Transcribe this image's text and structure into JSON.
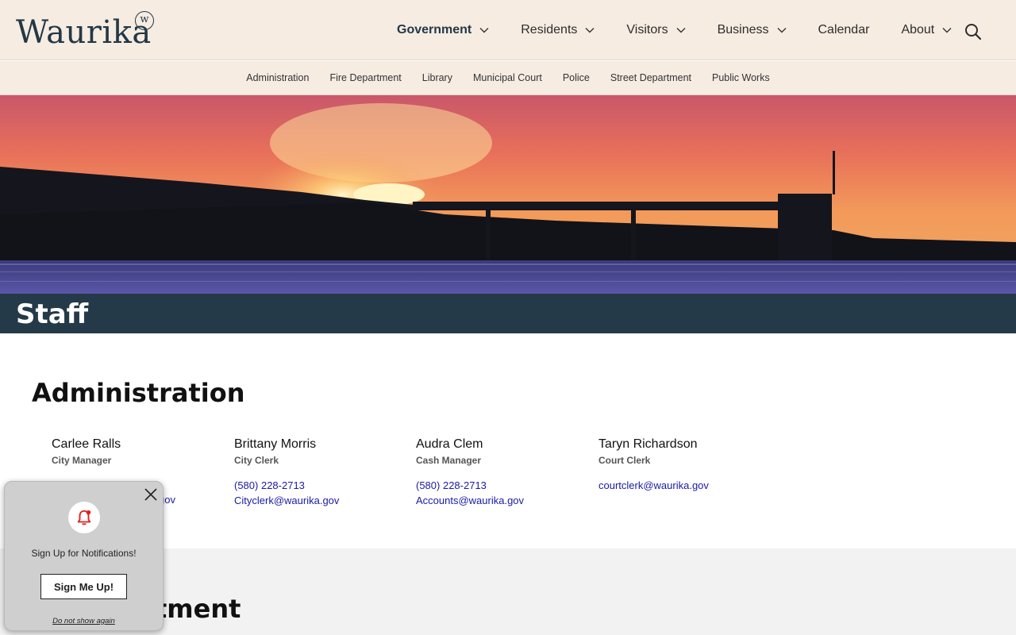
{
  "header": {
    "logo_text": "Waurika",
    "logo_mark": "w",
    "nav": [
      {
        "label": "Government",
        "has_dropdown": true,
        "active": true
      },
      {
        "label": "Residents",
        "has_dropdown": true
      },
      {
        "label": "Visitors",
        "has_dropdown": true
      },
      {
        "label": "Business",
        "has_dropdown": true
      },
      {
        "label": "Calendar",
        "has_dropdown": false
      },
      {
        "label": "About",
        "has_dropdown": true
      }
    ],
    "search_icon": "search-icon"
  },
  "subnav": [
    "Administration",
    "Fire Department",
    "Library",
    "Municipal Court",
    "Police",
    "Street Department",
    "Public Works"
  ],
  "page": {
    "title": "Staff"
  },
  "sections": {
    "administration": {
      "title": "Administration",
      "staff": [
        {
          "name": "Carlee Ralls",
          "role": "City Manager",
          "phone": "",
          "email": "gov"
        },
        {
          "name": "Brittany Morris",
          "role": "City Clerk",
          "phone": "(580) 228-2713",
          "email": "Cityclerk@waurika.gov"
        },
        {
          "name": "Audra Clem",
          "role": "Cash Manager",
          "phone": "(580) 228-2713",
          "email": "Accounts@waurika.gov"
        },
        {
          "name": "Taryn Richardson",
          "role": "Court Clerk",
          "phone": "",
          "email": "courtclerk@waurika.gov"
        }
      ]
    },
    "fire": {
      "title_visible": "tment"
    }
  },
  "notification": {
    "text": "Sign Up for Notifications!",
    "button": "Sign Me Up!",
    "dismiss": "Do not show again"
  },
  "colors": {
    "header_bg": "#f6ece2",
    "title_band": "#253a48",
    "link": "#1a1aa6",
    "bell": "#e02020"
  }
}
